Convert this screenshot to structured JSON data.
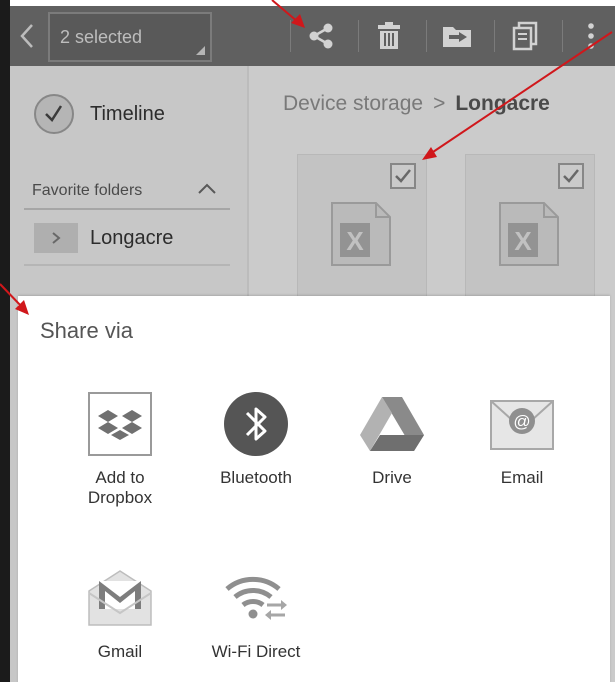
{
  "action_bar": {
    "selection_label": "2 selected"
  },
  "left_panel": {
    "timeline_label": "Timeline",
    "favorites_header": "Favorite folders",
    "folder_label": "Longacre"
  },
  "breadcrumb": {
    "root": "Device storage",
    "separator": ">",
    "current": "Longacre"
  },
  "share_dialog": {
    "title": "Share via",
    "items": [
      {
        "label": "Add to Dropbox",
        "icon": "dropbox-icon"
      },
      {
        "label": "Bluetooth",
        "icon": "bluetooth-icon"
      },
      {
        "label": "Drive",
        "icon": "drive-icon"
      },
      {
        "label": "Email",
        "icon": "email-icon"
      },
      {
        "label": "Gmail",
        "icon": "gmail-icon"
      },
      {
        "label": "Wi-Fi Direct",
        "icon": "wifi-direct-icon"
      }
    ]
  },
  "colors": {
    "action_bar": "#6e6e6e",
    "annotation_arrow": "#d0171b",
    "dialog_background": "#ffffff"
  }
}
